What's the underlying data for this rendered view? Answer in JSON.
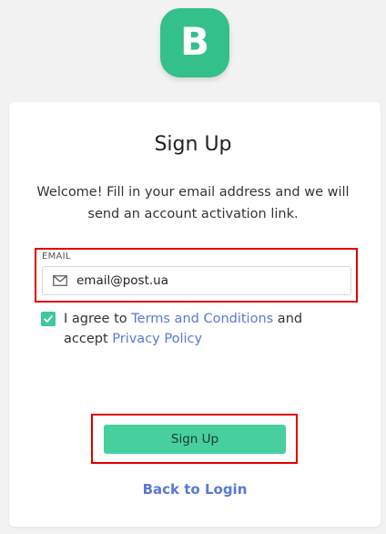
{
  "logo": {
    "letter": "B",
    "color": "#33c08a"
  },
  "title": "Sign Up",
  "welcome_text": "Welcome! Fill in your email address and we will send an account activation link.",
  "email": {
    "label": "EMAIL",
    "value": "email@post.ua",
    "icon": "mail-icon"
  },
  "agreement": {
    "checked": true,
    "prefix": "I agree to ",
    "terms_link": "Terms and Conditions",
    "middle": " and accept ",
    "privacy_link": "Privacy Policy"
  },
  "signup_button": {
    "label": "Sign Up",
    "color": "#47cf9e"
  },
  "back_link": "Back to Login",
  "colors": {
    "accent": "#3ec99a",
    "link": "#5a78d6",
    "highlight": "#e00000"
  }
}
